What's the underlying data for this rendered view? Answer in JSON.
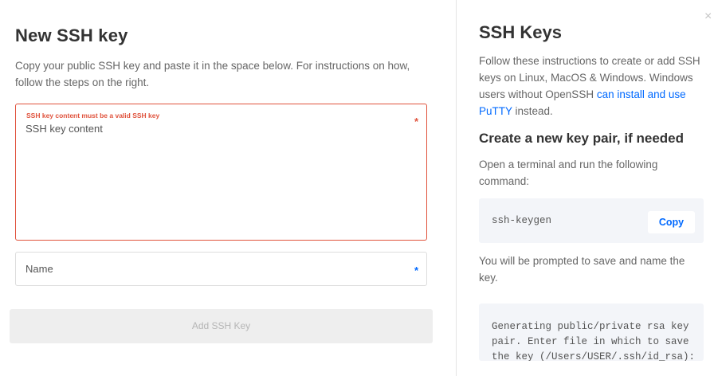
{
  "form": {
    "title": "New SSH key",
    "intro": "Copy your public SSH key and paste it in the space below. For instructions on how, follow the steps on the right.",
    "key_field": {
      "error": "SSH key content must be a valid SSH key",
      "label": "SSH key content",
      "required_marker": "*",
      "value": ""
    },
    "name_field": {
      "placeholder": "Name",
      "required_marker": "*",
      "value": ""
    },
    "submit_label": "Add SSH Key"
  },
  "help": {
    "close_glyph": "×",
    "title": "SSH Keys",
    "intro_text": "Follow these instructions to create or add SSH keys on Linux, MacOS & Windows. Windows users without OpenSSH ",
    "intro_link": "can install and use PuTTY",
    "intro_suffix": " instead.",
    "subheading": "Create a new key pair, if needed",
    "step1_text": "Open a terminal and run the following command:",
    "command": "ssh-keygen",
    "copy_label": "Copy",
    "step2_text": "You will be prompted to save and name the key.",
    "output": "Generating public/private rsa key pair. Enter file in which to save the key (/Users/USER/.ssh/id_rsa):"
  },
  "colors": {
    "error": "#e0533d",
    "accent": "#0069ff",
    "code_bg": "#f3f5f9",
    "disabled_bg": "#eeeeee"
  }
}
